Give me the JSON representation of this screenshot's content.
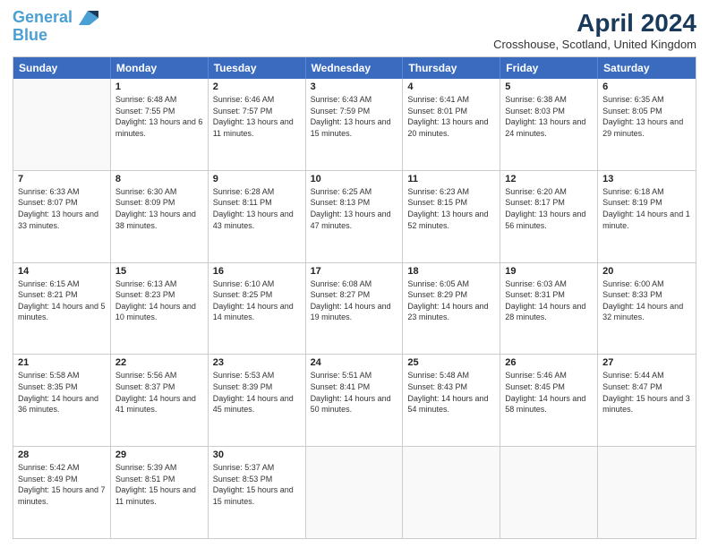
{
  "logo": {
    "line1": "General",
    "line2": "Blue"
  },
  "title": "April 2024",
  "subtitle": "Crosshouse, Scotland, United Kingdom",
  "days": [
    "Sunday",
    "Monday",
    "Tuesday",
    "Wednesday",
    "Thursday",
    "Friday",
    "Saturday"
  ],
  "weeks": [
    [
      {
        "day": "",
        "sunrise": "",
        "sunset": "",
        "daylight": ""
      },
      {
        "day": "1",
        "sunrise": "Sunrise: 6:48 AM",
        "sunset": "Sunset: 7:55 PM",
        "daylight": "Daylight: 13 hours and 6 minutes."
      },
      {
        "day": "2",
        "sunrise": "Sunrise: 6:46 AM",
        "sunset": "Sunset: 7:57 PM",
        "daylight": "Daylight: 13 hours and 11 minutes."
      },
      {
        "day": "3",
        "sunrise": "Sunrise: 6:43 AM",
        "sunset": "Sunset: 7:59 PM",
        "daylight": "Daylight: 13 hours and 15 minutes."
      },
      {
        "day": "4",
        "sunrise": "Sunrise: 6:41 AM",
        "sunset": "Sunset: 8:01 PM",
        "daylight": "Daylight: 13 hours and 20 minutes."
      },
      {
        "day": "5",
        "sunrise": "Sunrise: 6:38 AM",
        "sunset": "Sunset: 8:03 PM",
        "daylight": "Daylight: 13 hours and 24 minutes."
      },
      {
        "day": "6",
        "sunrise": "Sunrise: 6:35 AM",
        "sunset": "Sunset: 8:05 PM",
        "daylight": "Daylight: 13 hours and 29 minutes."
      }
    ],
    [
      {
        "day": "7",
        "sunrise": "Sunrise: 6:33 AM",
        "sunset": "Sunset: 8:07 PM",
        "daylight": "Daylight: 13 hours and 33 minutes."
      },
      {
        "day": "8",
        "sunrise": "Sunrise: 6:30 AM",
        "sunset": "Sunset: 8:09 PM",
        "daylight": "Daylight: 13 hours and 38 minutes."
      },
      {
        "day": "9",
        "sunrise": "Sunrise: 6:28 AM",
        "sunset": "Sunset: 8:11 PM",
        "daylight": "Daylight: 13 hours and 43 minutes."
      },
      {
        "day": "10",
        "sunrise": "Sunrise: 6:25 AM",
        "sunset": "Sunset: 8:13 PM",
        "daylight": "Daylight: 13 hours and 47 minutes."
      },
      {
        "day": "11",
        "sunrise": "Sunrise: 6:23 AM",
        "sunset": "Sunset: 8:15 PM",
        "daylight": "Daylight: 13 hours and 52 minutes."
      },
      {
        "day": "12",
        "sunrise": "Sunrise: 6:20 AM",
        "sunset": "Sunset: 8:17 PM",
        "daylight": "Daylight: 13 hours and 56 minutes."
      },
      {
        "day": "13",
        "sunrise": "Sunrise: 6:18 AM",
        "sunset": "Sunset: 8:19 PM",
        "daylight": "Daylight: 14 hours and 1 minute."
      }
    ],
    [
      {
        "day": "14",
        "sunrise": "Sunrise: 6:15 AM",
        "sunset": "Sunset: 8:21 PM",
        "daylight": "Daylight: 14 hours and 5 minutes."
      },
      {
        "day": "15",
        "sunrise": "Sunrise: 6:13 AM",
        "sunset": "Sunset: 8:23 PM",
        "daylight": "Daylight: 14 hours and 10 minutes."
      },
      {
        "day": "16",
        "sunrise": "Sunrise: 6:10 AM",
        "sunset": "Sunset: 8:25 PM",
        "daylight": "Daylight: 14 hours and 14 minutes."
      },
      {
        "day": "17",
        "sunrise": "Sunrise: 6:08 AM",
        "sunset": "Sunset: 8:27 PM",
        "daylight": "Daylight: 14 hours and 19 minutes."
      },
      {
        "day": "18",
        "sunrise": "Sunrise: 6:05 AM",
        "sunset": "Sunset: 8:29 PM",
        "daylight": "Daylight: 14 hours and 23 minutes."
      },
      {
        "day": "19",
        "sunrise": "Sunrise: 6:03 AM",
        "sunset": "Sunset: 8:31 PM",
        "daylight": "Daylight: 14 hours and 28 minutes."
      },
      {
        "day": "20",
        "sunrise": "Sunrise: 6:00 AM",
        "sunset": "Sunset: 8:33 PM",
        "daylight": "Daylight: 14 hours and 32 minutes."
      }
    ],
    [
      {
        "day": "21",
        "sunrise": "Sunrise: 5:58 AM",
        "sunset": "Sunset: 8:35 PM",
        "daylight": "Daylight: 14 hours and 36 minutes."
      },
      {
        "day": "22",
        "sunrise": "Sunrise: 5:56 AM",
        "sunset": "Sunset: 8:37 PM",
        "daylight": "Daylight: 14 hours and 41 minutes."
      },
      {
        "day": "23",
        "sunrise": "Sunrise: 5:53 AM",
        "sunset": "Sunset: 8:39 PM",
        "daylight": "Daylight: 14 hours and 45 minutes."
      },
      {
        "day": "24",
        "sunrise": "Sunrise: 5:51 AM",
        "sunset": "Sunset: 8:41 PM",
        "daylight": "Daylight: 14 hours and 50 minutes."
      },
      {
        "day": "25",
        "sunrise": "Sunrise: 5:48 AM",
        "sunset": "Sunset: 8:43 PM",
        "daylight": "Daylight: 14 hours and 54 minutes."
      },
      {
        "day": "26",
        "sunrise": "Sunrise: 5:46 AM",
        "sunset": "Sunset: 8:45 PM",
        "daylight": "Daylight: 14 hours and 58 minutes."
      },
      {
        "day": "27",
        "sunrise": "Sunrise: 5:44 AM",
        "sunset": "Sunset: 8:47 PM",
        "daylight": "Daylight: 15 hours and 3 minutes."
      }
    ],
    [
      {
        "day": "28",
        "sunrise": "Sunrise: 5:42 AM",
        "sunset": "Sunset: 8:49 PM",
        "daylight": "Daylight: 15 hours and 7 minutes."
      },
      {
        "day": "29",
        "sunrise": "Sunrise: 5:39 AM",
        "sunset": "Sunset: 8:51 PM",
        "daylight": "Daylight: 15 hours and 11 minutes."
      },
      {
        "day": "30",
        "sunrise": "Sunrise: 5:37 AM",
        "sunset": "Sunset: 8:53 PM",
        "daylight": "Daylight: 15 hours and 15 minutes."
      },
      {
        "day": "",
        "sunrise": "",
        "sunset": "",
        "daylight": ""
      },
      {
        "day": "",
        "sunrise": "",
        "sunset": "",
        "daylight": ""
      },
      {
        "day": "",
        "sunrise": "",
        "sunset": "",
        "daylight": ""
      },
      {
        "day": "",
        "sunrise": "",
        "sunset": "",
        "daylight": ""
      }
    ]
  ]
}
